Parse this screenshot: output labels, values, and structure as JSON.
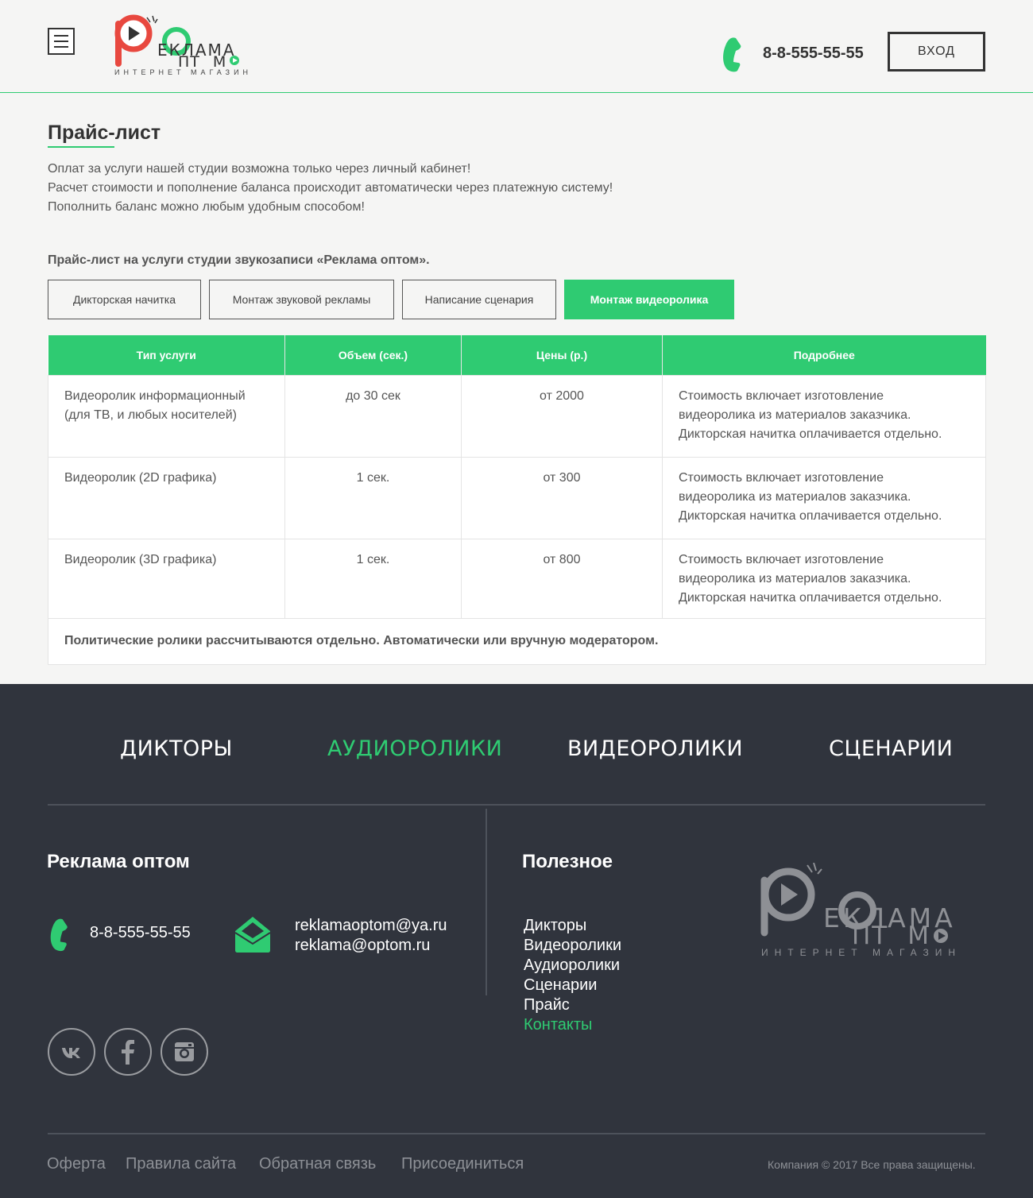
{
  "header": {
    "logo": {
      "mark_letter": "Р",
      "line1": "ЕКЛАМА",
      "line2": "ПТ",
      "line2_end": "М",
      "tagline": "ИНТЕРНЕТ МАГАЗИН"
    },
    "phone": "8-8-555-55-55",
    "login_label": "ВХОД",
    "icons": {
      "menu": "hamburger-icon",
      "phone": "phone-icon"
    }
  },
  "main": {
    "title": "Прайс-лист",
    "intro": [
      "Оплат за услуги нашей студии возможна только через личный кабинет!",
      "Расчет стоимости и пополнение баланса происходит автоматически через платежную систему!",
      "Пополнить баланс можно любым удобным способом!"
    ],
    "subtitle": "Прайс-лист на услуги студии звукозаписи «Реклама оптом».",
    "tabs": [
      {
        "label": "Дикторская начитка",
        "active": false
      },
      {
        "label": "Монтаж звуковой рекламы",
        "active": false
      },
      {
        "label": "Написание сценария",
        "active": false
      },
      {
        "label": "Монтаж видеоролика",
        "active": true
      }
    ],
    "table": {
      "headers": [
        "Тип услуги",
        "Объем (сек.)",
        "Цены (р.)",
        "Подробнее"
      ],
      "rows": [
        {
          "type": [
            "Видеоролик информационный",
            "(для ТВ, и любых носителей)"
          ],
          "volume": "до 30 сек",
          "price": "от 2000",
          "details": [
            "Стоимость включает изготовление",
            "видеоролика из материалов заказчика.",
            "Дикторская начитка оплачивается отдельно."
          ]
        },
        {
          "type": [
            "Видеоролик (2D графика)"
          ],
          "volume": "1 сек.",
          "price": "от 300",
          "details": [
            "Стоимость включает изготовление",
            "видеоролика из материалов заказчика.",
            "Дикторская начитка оплачивается отдельно."
          ]
        },
        {
          "type": [
            "Видеоролик (3D графика)"
          ],
          "volume": "1 сек.",
          "price": "от 800",
          "details": [
            "Стоимость включает изготовление",
            "видеоролика из материалов заказчика.",
            "Дикторская начитка оплачивается отдельно."
          ]
        }
      ],
      "note": "Политические ролики рассчитываются отдельно. Автоматически или вручную модератором."
    }
  },
  "footer": {
    "nav": [
      {
        "label": "ДИКТОРЫ",
        "active": false
      },
      {
        "label": "АУДИОРОЛИКИ",
        "active": true
      },
      {
        "label": "ВИДЕОРОЛИКИ",
        "active": false
      },
      {
        "label": "СЦЕНАРИИ",
        "active": false
      }
    ],
    "company_title": "Реклама оптом",
    "phone": "8-8-555-55-55",
    "emails": [
      "reklamaoptom@ya.ru",
      "reklama@optom.ru"
    ],
    "useful_title": "Полезное",
    "useful_links": [
      {
        "label": "Дикторы",
        "active": false
      },
      {
        "label": "Видеоролики",
        "active": false
      },
      {
        "label": "Аудиоролики",
        "active": false
      },
      {
        "label": "Сценарии",
        "active": false
      },
      {
        "label": "Прайс",
        "active": false
      },
      {
        "label": "Контакты",
        "active": true
      }
    ],
    "social": [
      "vk-icon",
      "facebook-icon",
      "instagram-icon"
    ],
    "bottom_links": [
      "Оферта",
      "Правила сайта",
      "Обратная связь",
      "Присоединиться"
    ],
    "copyright": "Компания © 2017  Все права защищены."
  },
  "colors": {
    "accent": "#2fcb72",
    "logo_red": "#e8483f",
    "footer_bg": "#30343d",
    "page_bg": "#f5f5f4"
  }
}
